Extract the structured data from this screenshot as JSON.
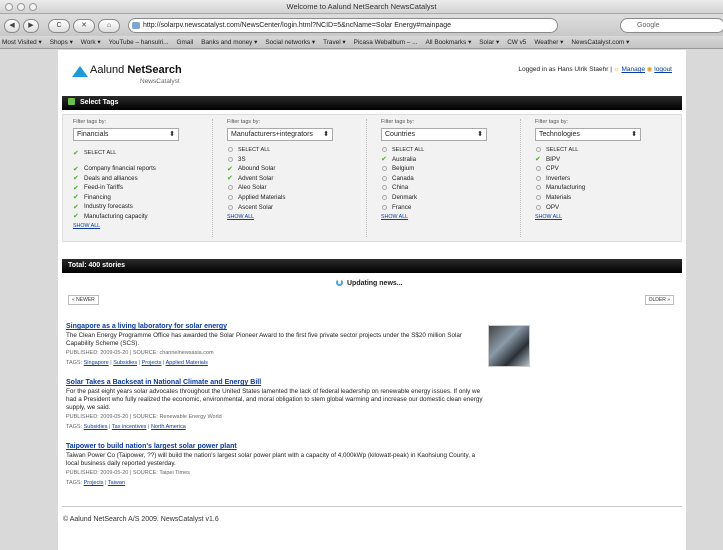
{
  "window": {
    "title": "Welcome to Aalund NetSearch NewsCatalyst"
  },
  "toolbar": {
    "back": "◀",
    "forward": "▶",
    "reload": "C",
    "stop": "✕",
    "home": "⌂",
    "url": "http://solarpv.newscatalyst.com/NewsCenter/login.html?NCID=5&ncName=Solar Energy#mainpage",
    "search_placeholder": "Google"
  },
  "bookmarks": [
    "Most Visited ▾",
    "Shops ▾",
    "Work ▾",
    "YouTube – hansulri...",
    "Gmail",
    "Banks and money ▾",
    "Social networks ▾",
    "Travel ▾",
    "Picasa Webalbum – ...",
    "All Bookmarks ▾",
    "Solar ▾",
    "CW v5",
    "Weather ▾",
    "NewsCatalyst.com ▾"
  ],
  "header": {
    "brand_plain": "Aalund ",
    "brand_bold": "NetSearch",
    "sub": "NewsCatalyst",
    "logged_in": "Logged in as Hans Ulrik Staehr",
    "manage": "Manage",
    "logout": "logout"
  },
  "select_tags": {
    "title": "Select Tags"
  },
  "filters": [
    {
      "label": "Filter tags by:",
      "value": "Financials",
      "select_all": "SELECT ALL",
      "options": [
        {
          "text": "Company financial reports",
          "checked": true
        },
        {
          "text": "Deals and alliances",
          "checked": true
        },
        {
          "text": "Feed-in Tariffs",
          "checked": true
        },
        {
          "text": "Financing",
          "checked": true
        },
        {
          "text": "Industry forecasts",
          "checked": true
        },
        {
          "text": "Manufacturing capacity",
          "checked": true
        }
      ],
      "show_all": "SHOW ALL"
    },
    {
      "label": "Filter tags by:",
      "value": "Manufacturers+integrators",
      "select_all": "SELECT ALL",
      "options": [
        {
          "text": "3S",
          "checked": false
        },
        {
          "text": "Abound Solar",
          "checked": true
        },
        {
          "text": "Advent Solar",
          "checked": true
        },
        {
          "text": "Aleo Solar",
          "checked": false
        },
        {
          "text": "Applied Materials",
          "checked": false
        },
        {
          "text": "Ascent Solar",
          "checked": false
        }
      ],
      "show_all": "SHOW ALL"
    },
    {
      "label": "Filter tags by:",
      "value": "Countries",
      "select_all": "SELECT ALL",
      "options": [
        {
          "text": "Australia",
          "checked": true
        },
        {
          "text": "Belgium",
          "checked": false
        },
        {
          "text": "Canada",
          "checked": false
        },
        {
          "text": "China",
          "checked": false
        },
        {
          "text": "Denmark",
          "checked": false
        },
        {
          "text": "France",
          "checked": false
        }
      ],
      "show_all": "SHOW ALL"
    },
    {
      "label": "Filter tags by:",
      "value": "Technologies",
      "select_all": "SELECT ALL",
      "options": [
        {
          "text": "BIPV",
          "checked": true
        },
        {
          "text": "CPV",
          "checked": false
        },
        {
          "text": "Inverters",
          "checked": false
        },
        {
          "text": "Manufacturing",
          "checked": false
        },
        {
          "text": "Materials",
          "checked": false
        },
        {
          "text": "OPV",
          "checked": false
        }
      ],
      "show_all": "SHOW ALL"
    }
  ],
  "total": {
    "text": "Total: 400 stories"
  },
  "updating": "Updating news...",
  "nav": {
    "newer": "« NEWER",
    "older": "OLDER »"
  },
  "stories": [
    {
      "title": "Singapore as a living laboratory for solar energy",
      "desc": "The Clean Energy Programme Office has awarded the Solar Pioneer Award to the first five private sector projects under the S$20 million Solar Capability Scheme (SCS).",
      "meta": "PUBLISHED: 2009-05-20  |  SOURCE: channelnewsasia.com",
      "tags_label": "TAGS:",
      "tags": [
        "Singapore",
        "Subsidies",
        "Projects",
        "Applied Materials"
      ]
    },
    {
      "title": "Solar Takes a Backseat in National Climate and Energy Bill",
      "desc": "For the past eight years solar advocates throughout the United States lamented the lack of federal leadership on renewable energy issues. If only we had a President who fully realized the economic, environmental, and moral obligation to stem global warming and increase our domestic clean energy supply, we said.",
      "meta": "PUBLISHED: 2009-05-20  |  SOURCE: Renewable Energy World",
      "tags_label": "TAGS:",
      "tags": [
        "Subsidies",
        "Tax incentives",
        "North America"
      ]
    },
    {
      "title": "Taipower to build nation's largest solar power plant",
      "desc": "Taiwan Power Co (Taipower, ??) will build the nation's largest solar power plant with a capacity of 4,000kWp (kilowatt-peak) in Kaohsiung County, a local business daily reported yesterday.",
      "meta": "PUBLISHED: 2009-05-20  |  SOURCE: Taipei Times",
      "tags_label": "TAGS:",
      "tags": [
        "Projects",
        "Taiwan"
      ]
    }
  ],
  "footer": "© Aalund NetSearch A/S 2009. NewsCatalyst v1.6"
}
